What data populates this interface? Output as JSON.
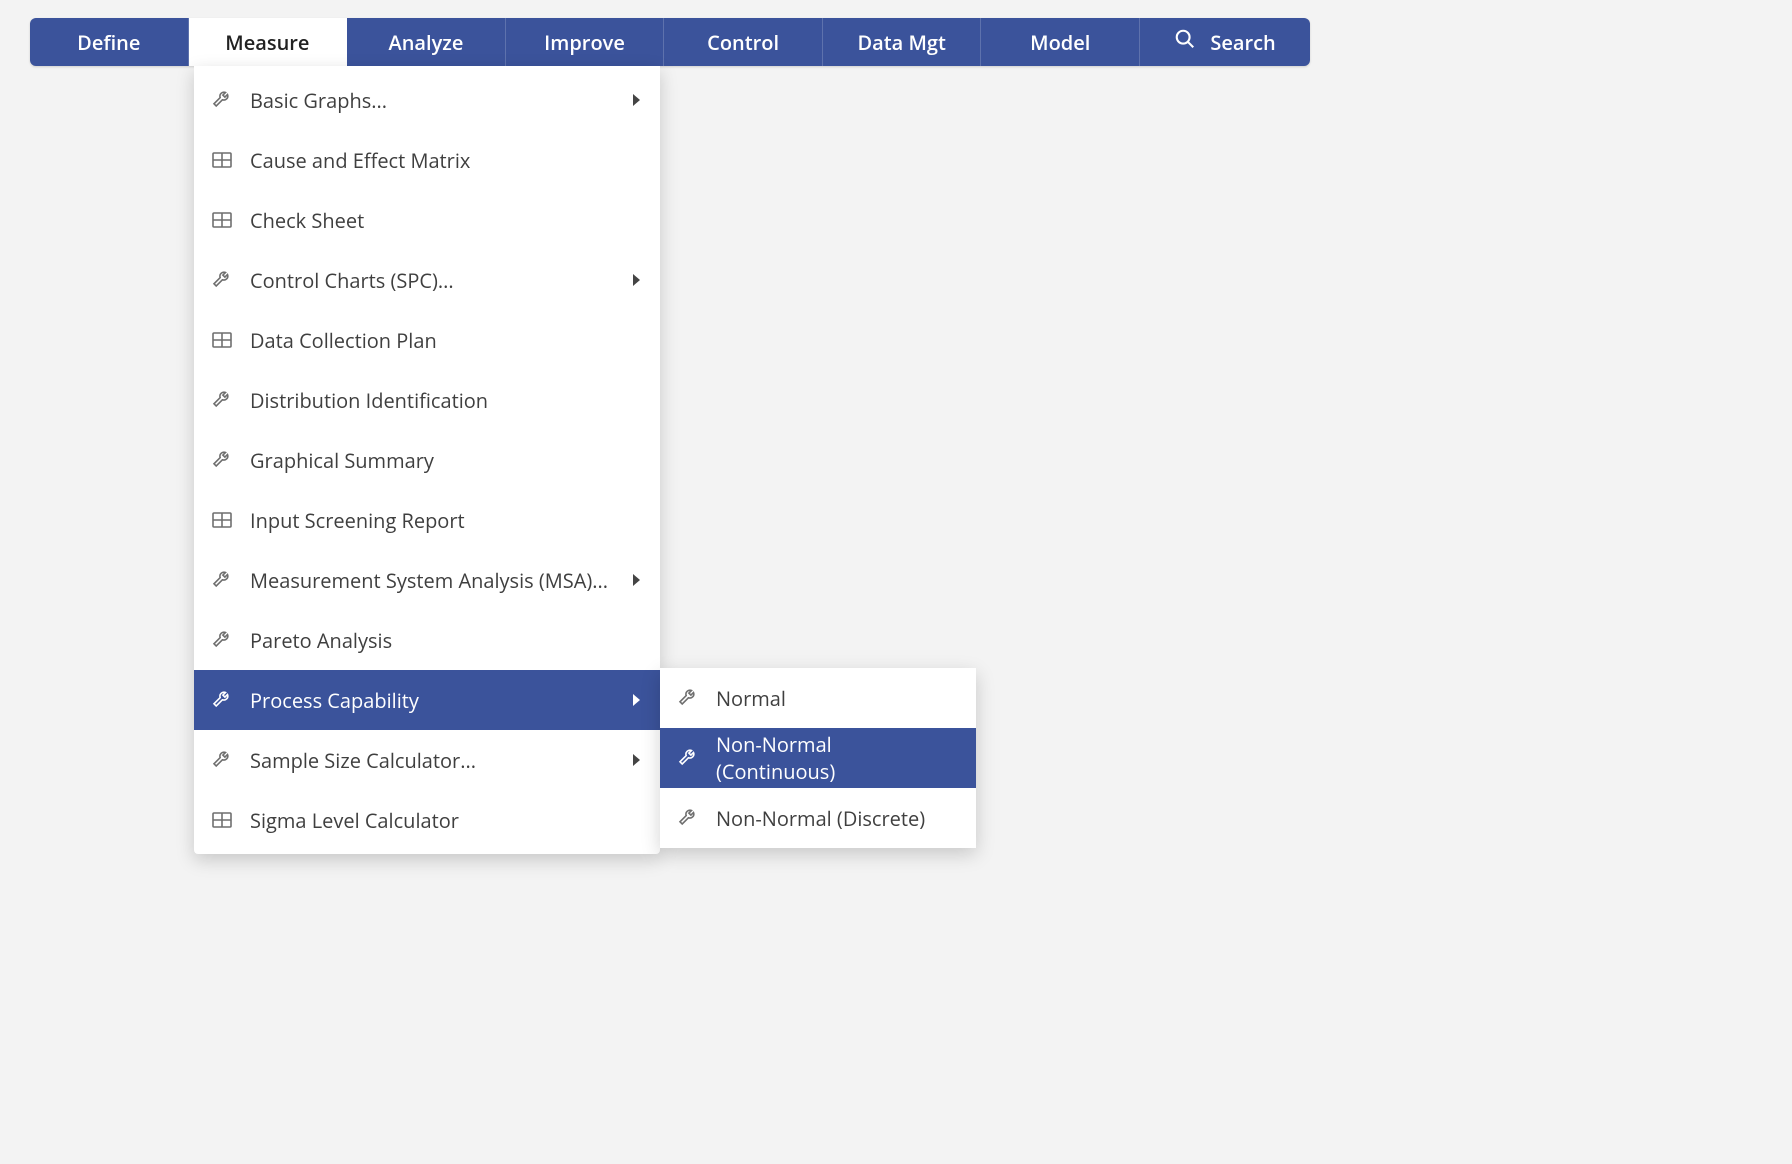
{
  "nav": {
    "tabs": [
      {
        "label": "Define",
        "active": false
      },
      {
        "label": "Measure",
        "active": true
      },
      {
        "label": "Analyze",
        "active": false
      },
      {
        "label": "Improve",
        "active": false
      },
      {
        "label": "Control",
        "active": false
      },
      {
        "label": "Data Mgt",
        "active": false
      },
      {
        "label": "Model",
        "active": false
      }
    ],
    "search_label": "Search"
  },
  "measure_menu": {
    "items": [
      {
        "label": "Basic Graphs...",
        "icon": "wrench",
        "submenu": true,
        "selected": false
      },
      {
        "label": "Cause and Effect Matrix",
        "icon": "table",
        "submenu": false,
        "selected": false
      },
      {
        "label": "Check Sheet",
        "icon": "table",
        "submenu": false,
        "selected": false
      },
      {
        "label": "Control Charts (SPC)...",
        "icon": "wrench",
        "submenu": true,
        "selected": false
      },
      {
        "label": "Data Collection Plan",
        "icon": "table",
        "submenu": false,
        "selected": false
      },
      {
        "label": "Distribution Identification",
        "icon": "wrench",
        "submenu": false,
        "selected": false
      },
      {
        "label": "Graphical Summary",
        "icon": "wrench",
        "submenu": false,
        "selected": false
      },
      {
        "label": "Input Screening Report",
        "icon": "table",
        "submenu": false,
        "selected": false
      },
      {
        "label": "Measurement System Analysis (MSA)...",
        "icon": "wrench",
        "submenu": true,
        "selected": false
      },
      {
        "label": "Pareto Analysis",
        "icon": "wrench",
        "submenu": false,
        "selected": false
      },
      {
        "label": "Process Capability",
        "icon": "wrench",
        "submenu": true,
        "selected": true
      },
      {
        "label": "Sample Size Calculator...",
        "icon": "wrench",
        "submenu": true,
        "selected": false
      },
      {
        "label": "Sigma Level Calculator",
        "icon": "table",
        "submenu": false,
        "selected": false
      }
    ]
  },
  "process_capability_submenu": {
    "items": [
      {
        "label": "Normal",
        "icon": "wrench",
        "selected": false
      },
      {
        "label": "Non-Normal (Continuous)",
        "icon": "wrench",
        "selected": true
      },
      {
        "label": "Non-Normal (Discrete)",
        "icon": "wrench",
        "selected": false
      }
    ]
  }
}
